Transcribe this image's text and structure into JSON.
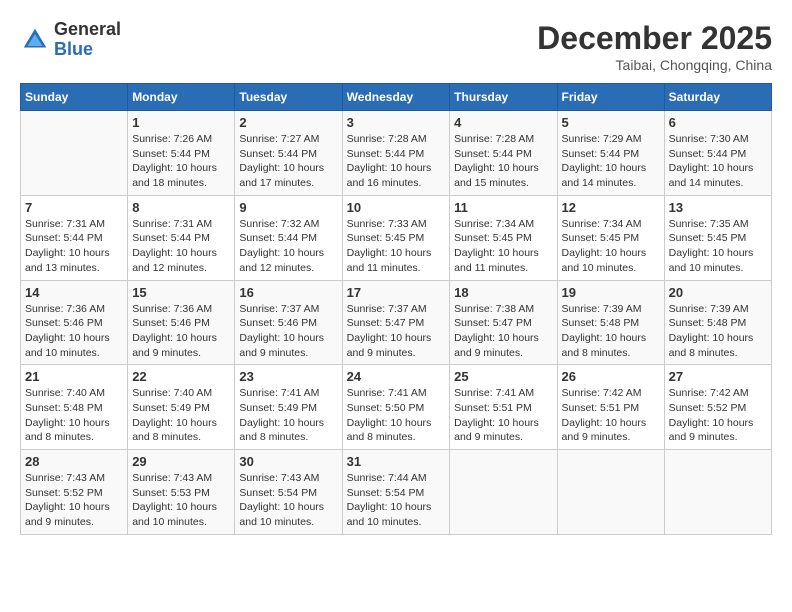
{
  "header": {
    "logo_general": "General",
    "logo_blue": "Blue",
    "month_title": "December 2025",
    "location": "Taibai, Chongqing, China"
  },
  "days_of_week": [
    "Sunday",
    "Monday",
    "Tuesday",
    "Wednesday",
    "Thursday",
    "Friday",
    "Saturday"
  ],
  "weeks": [
    [
      {
        "num": "",
        "info": ""
      },
      {
        "num": "1",
        "info": "Sunrise: 7:26 AM\nSunset: 5:44 PM\nDaylight: 10 hours and 18 minutes."
      },
      {
        "num": "2",
        "info": "Sunrise: 7:27 AM\nSunset: 5:44 PM\nDaylight: 10 hours and 17 minutes."
      },
      {
        "num": "3",
        "info": "Sunrise: 7:28 AM\nSunset: 5:44 PM\nDaylight: 10 hours and 16 minutes."
      },
      {
        "num": "4",
        "info": "Sunrise: 7:28 AM\nSunset: 5:44 PM\nDaylight: 10 hours and 15 minutes."
      },
      {
        "num": "5",
        "info": "Sunrise: 7:29 AM\nSunset: 5:44 PM\nDaylight: 10 hours and 14 minutes."
      },
      {
        "num": "6",
        "info": "Sunrise: 7:30 AM\nSunset: 5:44 PM\nDaylight: 10 hours and 14 minutes."
      }
    ],
    [
      {
        "num": "7",
        "info": "Sunrise: 7:31 AM\nSunset: 5:44 PM\nDaylight: 10 hours and 13 minutes."
      },
      {
        "num": "8",
        "info": "Sunrise: 7:31 AM\nSunset: 5:44 PM\nDaylight: 10 hours and 12 minutes."
      },
      {
        "num": "9",
        "info": "Sunrise: 7:32 AM\nSunset: 5:44 PM\nDaylight: 10 hours and 12 minutes."
      },
      {
        "num": "10",
        "info": "Sunrise: 7:33 AM\nSunset: 5:45 PM\nDaylight: 10 hours and 11 minutes."
      },
      {
        "num": "11",
        "info": "Sunrise: 7:34 AM\nSunset: 5:45 PM\nDaylight: 10 hours and 11 minutes."
      },
      {
        "num": "12",
        "info": "Sunrise: 7:34 AM\nSunset: 5:45 PM\nDaylight: 10 hours and 10 minutes."
      },
      {
        "num": "13",
        "info": "Sunrise: 7:35 AM\nSunset: 5:45 PM\nDaylight: 10 hours and 10 minutes."
      }
    ],
    [
      {
        "num": "14",
        "info": "Sunrise: 7:36 AM\nSunset: 5:46 PM\nDaylight: 10 hours and 10 minutes."
      },
      {
        "num": "15",
        "info": "Sunrise: 7:36 AM\nSunset: 5:46 PM\nDaylight: 10 hours and 9 minutes."
      },
      {
        "num": "16",
        "info": "Sunrise: 7:37 AM\nSunset: 5:46 PM\nDaylight: 10 hours and 9 minutes."
      },
      {
        "num": "17",
        "info": "Sunrise: 7:37 AM\nSunset: 5:47 PM\nDaylight: 10 hours and 9 minutes."
      },
      {
        "num": "18",
        "info": "Sunrise: 7:38 AM\nSunset: 5:47 PM\nDaylight: 10 hours and 9 minutes."
      },
      {
        "num": "19",
        "info": "Sunrise: 7:39 AM\nSunset: 5:48 PM\nDaylight: 10 hours and 8 minutes."
      },
      {
        "num": "20",
        "info": "Sunrise: 7:39 AM\nSunset: 5:48 PM\nDaylight: 10 hours and 8 minutes."
      }
    ],
    [
      {
        "num": "21",
        "info": "Sunrise: 7:40 AM\nSunset: 5:48 PM\nDaylight: 10 hours and 8 minutes."
      },
      {
        "num": "22",
        "info": "Sunrise: 7:40 AM\nSunset: 5:49 PM\nDaylight: 10 hours and 8 minutes."
      },
      {
        "num": "23",
        "info": "Sunrise: 7:41 AM\nSunset: 5:49 PM\nDaylight: 10 hours and 8 minutes."
      },
      {
        "num": "24",
        "info": "Sunrise: 7:41 AM\nSunset: 5:50 PM\nDaylight: 10 hours and 8 minutes."
      },
      {
        "num": "25",
        "info": "Sunrise: 7:41 AM\nSunset: 5:51 PM\nDaylight: 10 hours and 9 minutes."
      },
      {
        "num": "26",
        "info": "Sunrise: 7:42 AM\nSunset: 5:51 PM\nDaylight: 10 hours and 9 minutes."
      },
      {
        "num": "27",
        "info": "Sunrise: 7:42 AM\nSunset: 5:52 PM\nDaylight: 10 hours and 9 minutes."
      }
    ],
    [
      {
        "num": "28",
        "info": "Sunrise: 7:43 AM\nSunset: 5:52 PM\nDaylight: 10 hours and 9 minutes."
      },
      {
        "num": "29",
        "info": "Sunrise: 7:43 AM\nSunset: 5:53 PM\nDaylight: 10 hours and 10 minutes."
      },
      {
        "num": "30",
        "info": "Sunrise: 7:43 AM\nSunset: 5:54 PM\nDaylight: 10 hours and 10 minutes."
      },
      {
        "num": "31",
        "info": "Sunrise: 7:44 AM\nSunset: 5:54 PM\nDaylight: 10 hours and 10 minutes."
      },
      {
        "num": "",
        "info": ""
      },
      {
        "num": "",
        "info": ""
      },
      {
        "num": "",
        "info": ""
      }
    ]
  ]
}
